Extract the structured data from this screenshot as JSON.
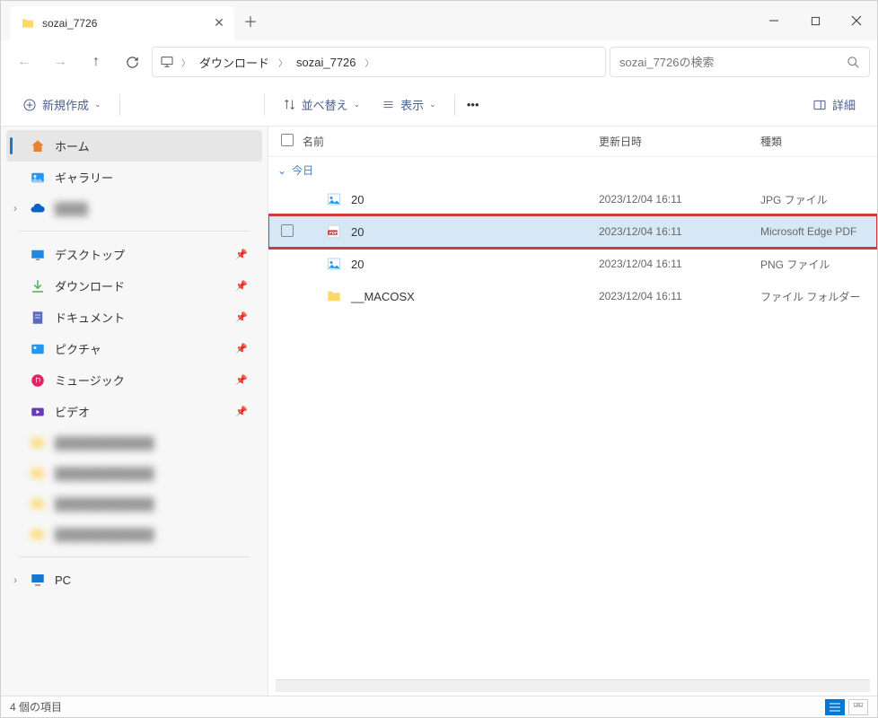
{
  "tab": {
    "title": "sozai_7726"
  },
  "breadcrumb": {
    "items": [
      "ダウンロード",
      "sozai_7726"
    ]
  },
  "search": {
    "placeholder": "sozai_7726の検索"
  },
  "toolbar": {
    "new_label": "新規作成",
    "sort_label": "並べ替え",
    "view_label": "表示",
    "details_label": "詳細"
  },
  "sidebar": {
    "home": "ホーム",
    "gallery": "ギャラリー",
    "desktop": "デスクトップ",
    "downloads": "ダウンロード",
    "documents": "ドキュメント",
    "pictures": "ピクチャ",
    "music": "ミュージック",
    "videos": "ビデオ",
    "pc": "PC"
  },
  "columns": {
    "name": "名前",
    "date": "更新日時",
    "type": "種類"
  },
  "group": "今日",
  "files": [
    {
      "name": "20",
      "date": "2023/12/04 16:11",
      "type": "JPG ファイル",
      "icon": "image"
    },
    {
      "name": "20",
      "date": "2023/12/04 16:11",
      "type": "Microsoft Edge PDF",
      "icon": "pdf",
      "selected": true
    },
    {
      "name": "20",
      "date": "2023/12/04 16:11",
      "type": "PNG ファイル",
      "icon": "image"
    },
    {
      "name": "__MACOSX",
      "date": "2023/12/04 16:11",
      "type": "ファイル フォルダー",
      "icon": "folder"
    }
  ],
  "status": "4 個の項目"
}
